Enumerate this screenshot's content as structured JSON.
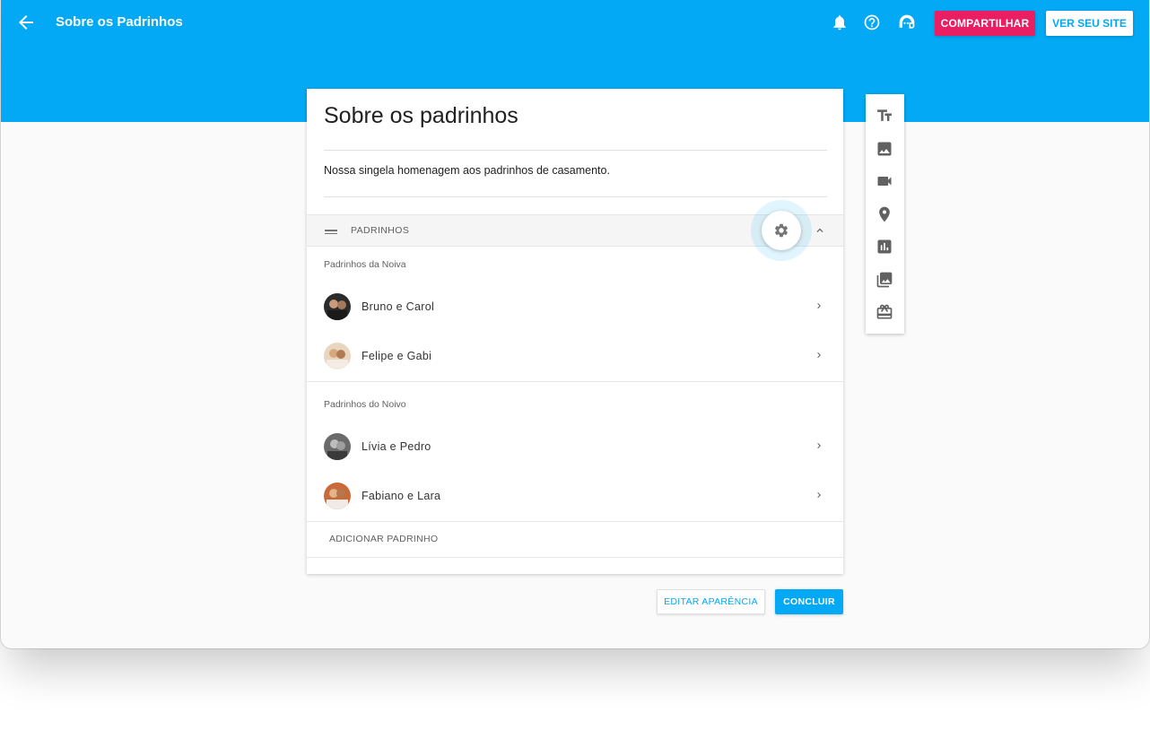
{
  "header": {
    "title": "Sobre os Padrinhos",
    "share_label": "COMPARTILHAR",
    "view_site_label": "VER SEU SITE"
  },
  "page": {
    "heading": "Sobre os padrinhos",
    "description": "Nossa singela homenagem aos padrinhos de casamento."
  },
  "section": {
    "title": "PADRINHOS",
    "groups": [
      {
        "label": "Padrinhos da Noiva",
        "items": [
          {
            "name": "Bruno e Carol"
          },
          {
            "name": "Felipe e Gabi"
          }
        ]
      },
      {
        "label": "Padrinhos do Noivo",
        "items": [
          {
            "name": "Lívia e Pedro"
          },
          {
            "name": "Fabiano e Lara"
          }
        ]
      }
    ],
    "add_label": "ADICIONAR PADRINHO"
  },
  "footer": {
    "edit_label": "EDITAR APARÊNCIA",
    "done_label": "CONCLUIR"
  },
  "toolbar_icons": [
    "text-icon",
    "image-icon",
    "video-icon",
    "location-icon",
    "chart-icon",
    "gallery-icon",
    "gift-icon"
  ],
  "colors": {
    "primary": "#03a9f4",
    "accent": "#e91e63"
  }
}
